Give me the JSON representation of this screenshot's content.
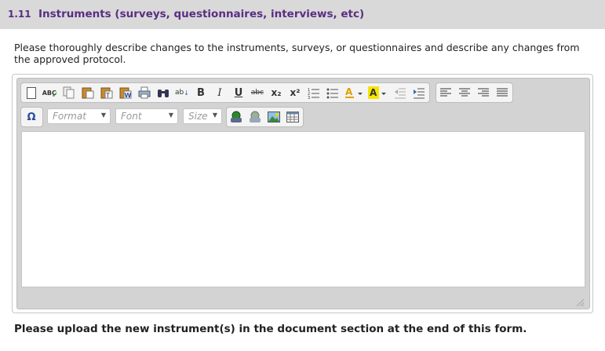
{
  "section": {
    "number": "1.11",
    "title": "Instruments (surveys, questionnaires, interviews, etc)"
  },
  "description": "Please thoroughly describe changes to the instruments, surveys, or questionnaires and describe any changes from the approved protocol.",
  "toolbar": {
    "bold_label": "B",
    "italic_label": "I",
    "underline_label": "U",
    "strike_label": "abc",
    "subscript_label": "x₂",
    "superscript_label": "x²",
    "special_char_label": "Ω",
    "format_label": "Format",
    "font_label": "Font",
    "size_label": "Size",
    "icons": [
      "new-page-icon",
      "spellcheck-icon",
      "copy-icon",
      "paste-icon",
      "paste-text-icon",
      "paste-word-icon",
      "print-icon",
      "find-icon",
      "replace-icon",
      "bold-icon",
      "italic-icon",
      "underline-icon",
      "strikethrough-icon",
      "subscript-icon",
      "superscript-icon",
      "numbered-list-icon",
      "bulleted-list-icon",
      "text-color-icon",
      "background-color-icon",
      "outdent-icon",
      "indent-icon",
      "align-left-icon",
      "align-center-icon",
      "align-right-icon",
      "justify-icon",
      "special-char-icon",
      "link-icon",
      "unlink-icon",
      "image-icon",
      "table-icon"
    ]
  },
  "editor": {
    "content": ""
  },
  "upload_note": "Please upload the new instrument(s) in the document section at the end of this form.",
  "colors": {
    "header_bg": "#d9d9d9",
    "header_text": "#5a2d82",
    "text_color_a": "#e0a000",
    "highlight": "#f5e400"
  }
}
